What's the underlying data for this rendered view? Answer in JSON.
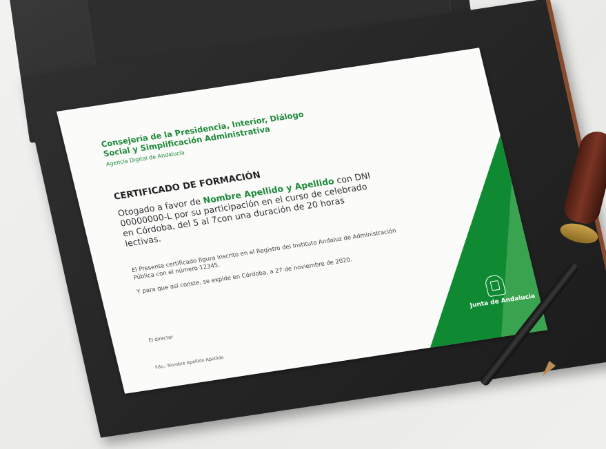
{
  "certificate": {
    "org_line1": "Consejería de la Presidencia, Interior, Diálogo",
    "org_line2": "Social y Simplificación Administrativa",
    "agency": "Agencia Digital de Andalucía",
    "title": "CERTIFICADO DE FORMACIÓN",
    "body_prefix": "Otogado a favor de ",
    "recipient_name": "Nombre Apellido y Apellido",
    "body_rest": "con DNI 00000000-L por su participación en el curso de celebrado en Córdoba, del 5 al 7con una duración de 20 horas lectivas.",
    "registry": "El Presente certificado figura inscrito en el Registro del Instituto Andaluz de Administración Pública con el número 12345.",
    "issued": "Y para que así conste, se expide en Córdoba, a 27 de noviembre de 2020.",
    "director": "El director",
    "signed_by": "Fdo.: Nombre Apellido Apellido",
    "emblem_text": "Junta de Andalucía"
  },
  "colors": {
    "accent_green": "#1e8a3a",
    "band_green": "#0f8a32",
    "folder": "#262626",
    "background": "#eeeeec"
  },
  "icons": [
    "junta-emblem-icon",
    "wax-seal",
    "pen"
  ]
}
